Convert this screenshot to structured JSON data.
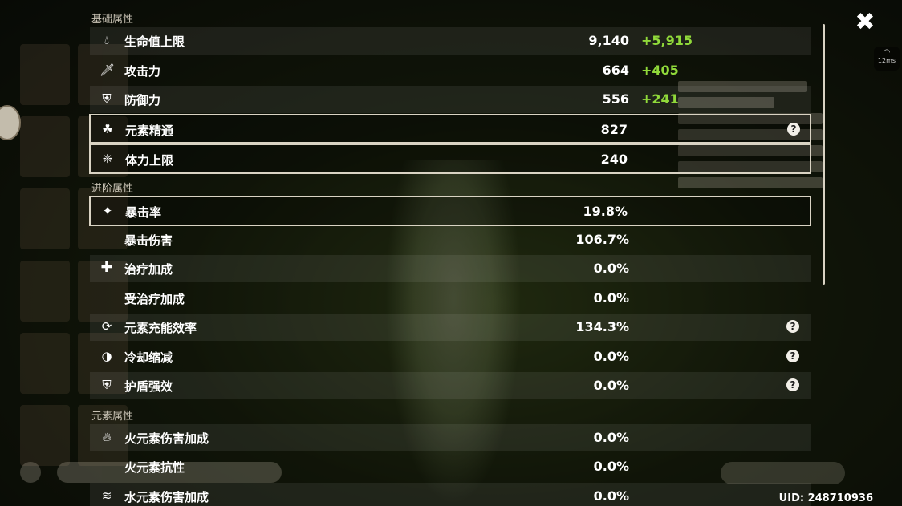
{
  "window": {
    "close_icon": "close-x-icon"
  },
  "status": {
    "ping": "12ms",
    "ping_icon": "wifi-icon"
  },
  "uid": "UID: 248710936",
  "colors": {
    "bonus": "#90d93a",
    "text": "#ffffff",
    "section": "#c8c2b4",
    "selected_border": "#d9d3c3"
  },
  "sections": {
    "base": {
      "title": "基础属性",
      "rows": [
        {
          "icon": "hp-drop-icon",
          "label": "生命值上限",
          "value": "9,140",
          "bonus": "+5,915"
        },
        {
          "icon": "atk-sword-icon",
          "label": "攻击力",
          "value": "664",
          "bonus": "+405"
        },
        {
          "icon": "def-shield-icon",
          "label": "防御力",
          "value": "556",
          "bonus": "+241"
        },
        {
          "icon": "elemental-mastery-icon",
          "label": "元素精通",
          "value": "827",
          "bonus": ""
        },
        {
          "icon": "stamina-icon",
          "label": "体力上限",
          "value": "240",
          "bonus": ""
        }
      ]
    },
    "advanced": {
      "title": "进阶属性",
      "rows": [
        {
          "icon": "crit-rate-icon",
          "label": "暴击率",
          "value": "19.8%"
        },
        {
          "icon": "",
          "label": "暴击伤害",
          "value": "106.7%"
        },
        {
          "icon": "healing-cross-icon",
          "label": "治疗加成",
          "value": "0.0%"
        },
        {
          "icon": "",
          "label": "受治疗加成",
          "value": "0.0%"
        },
        {
          "icon": "energy-recharge-icon",
          "label": "元素充能效率",
          "value": "134.3%"
        },
        {
          "icon": "cd-reduction-icon",
          "label": "冷却缩减",
          "value": "0.0%"
        },
        {
          "icon": "shield-strength-icon",
          "label": "护盾强效",
          "value": "0.0%"
        }
      ]
    },
    "elemental": {
      "title": "元素属性",
      "rows": [
        {
          "icon": "pyro-icon",
          "label": "火元素伤害加成",
          "value": "0.0%"
        },
        {
          "icon": "",
          "label": "火元素抗性",
          "value": "0.0%"
        },
        {
          "icon": "hydro-icon",
          "label": "水元素伤害加成",
          "value": "0.0%"
        }
      ]
    }
  }
}
